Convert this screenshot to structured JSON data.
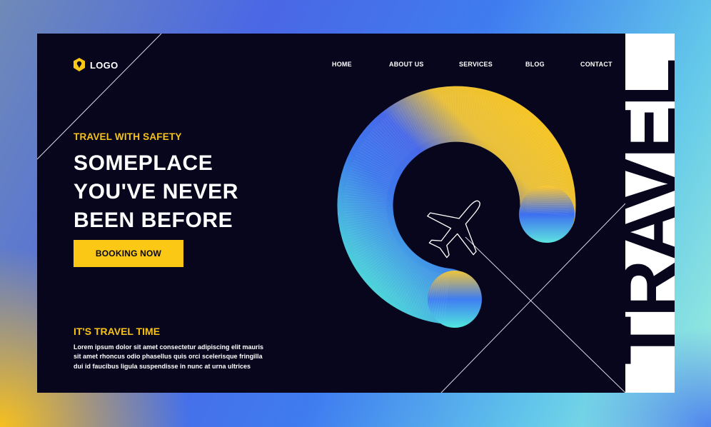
{
  "logo": {
    "text": "LOGO",
    "icon": "location-pin-icon",
    "color": "#fcc816"
  },
  "nav": {
    "items": [
      "HOME",
      "ABOUT US",
      "SERVICES",
      "BLOG",
      "CONTACT"
    ]
  },
  "hero": {
    "eyebrow": "TRAVEL WITH SAFETY",
    "headline": [
      "SOMEPLACE",
      "YOU'VE NEVER",
      "BEEN BEFORE"
    ],
    "cta_label": "BOOKING NOW"
  },
  "info": {
    "title": "IT'S TRAVEL TIME",
    "body": [
      "Lorem ipsum dolor sit amet consectetur adipiscing elit mauris",
      "sit amet rhoncus odio phasellus quis orci scelerisque fringilla",
      "dui id faucibus ligula suspendisse in nunc at urna ultrices"
    ]
  },
  "side_word": "TRAVEL",
  "illustration": {
    "icon": "airplane-icon"
  },
  "colors": {
    "background": "#07061c",
    "accent": "#fcc816",
    "text": "#ffffff"
  }
}
